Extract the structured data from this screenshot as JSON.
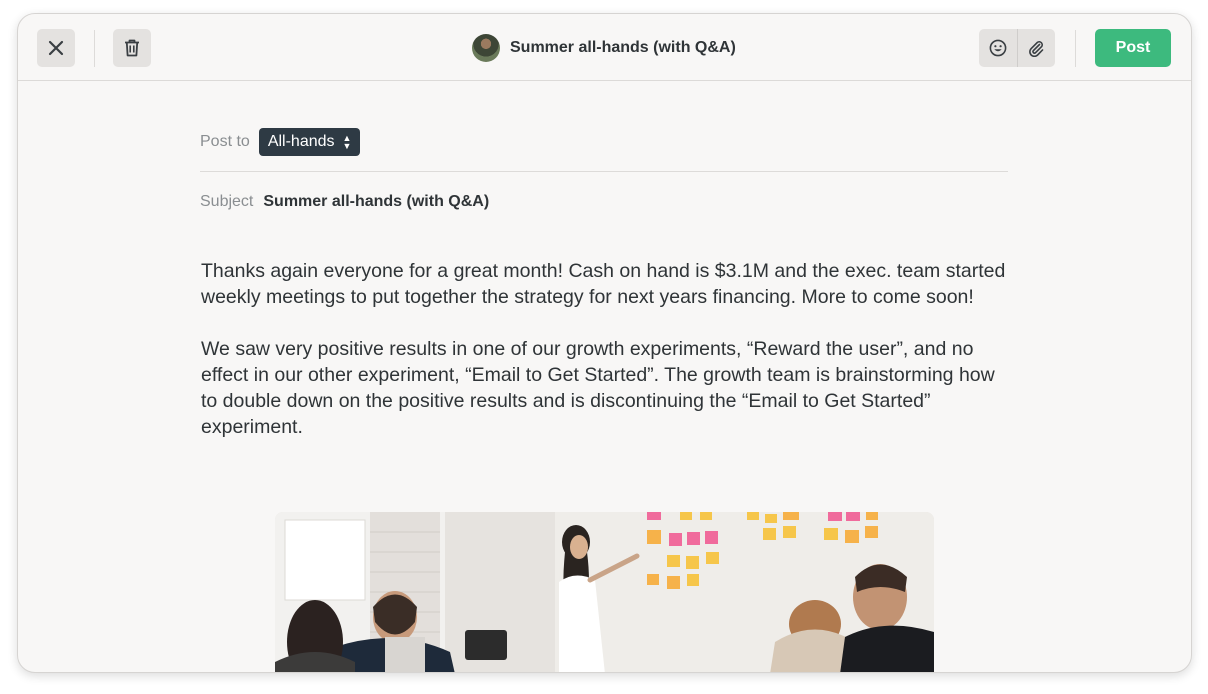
{
  "header": {
    "title": "Summer all-hands (with Q&A)",
    "post_label": "Post",
    "icons": {
      "close": "close-icon",
      "delete": "trash-icon",
      "emoji": "emoji-icon",
      "attach": "paperclip-icon"
    }
  },
  "composer": {
    "post_to_label": "Post to",
    "channel": "All-hands",
    "subject_label": "Subject",
    "subject": "Summer all-hands (with Q&A)",
    "paragraphs": [
      "Thanks again everyone for a great month! Cash on hand is $3.1M and the exec. team started weekly meetings to put together the strategy for next years financing. More to come soon!",
      "We saw very positive results in one of our growth experiments, “Reward the user”, and no effect in our other experiment, “Email to Get Started”. The growth team is brainstorming how to double down on the positive results and is discontinuing the “Email to Get Started” experiment."
    ]
  },
  "colors": {
    "accent_post": "#3dba7e",
    "channel_pill": "#2e3a44",
    "text": "#2f3437"
  }
}
